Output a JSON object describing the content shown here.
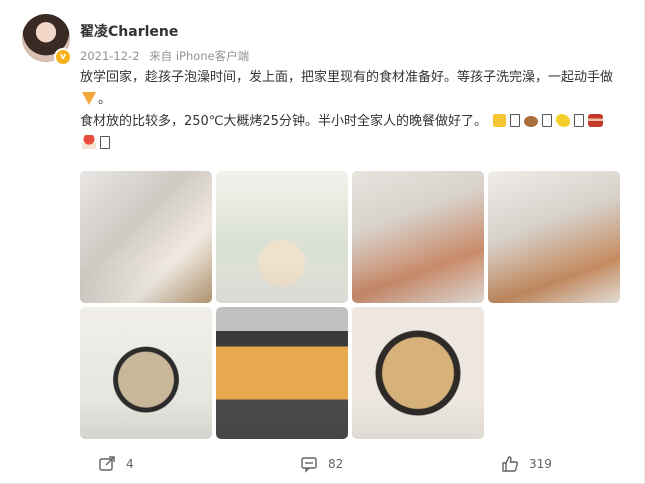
{
  "post": {
    "username": "翟凌Charlene",
    "date": "2021-12-2",
    "source": "来自 iPhone客户端",
    "text_line1": "放学回家，趁孩子泡澡时间，发上面，把家里现有的食材准备好。等孩子洗完澡，一起动手做",
    "text_line2": "食材放的比较多，250℃大概烤25分钟。半小时全家人的晚餐做好了。"
  },
  "icons": {
    "verified": "verified-badge-icon",
    "pizza": "pizza-emoji-icon",
    "cheese": "cheese-emoji-icon",
    "potato": "potato-emoji-icon",
    "corn": "corn-emoji-icon",
    "bacon": "bacon-emoji-icon",
    "mushroom": "mushroom-emoji-icon",
    "missing": "missing-glyph-icon"
  },
  "photos": [
    "photo-1",
    "photo-2",
    "photo-3",
    "photo-4",
    "photo-5",
    "photo-6",
    "photo-7"
  ],
  "actions": {
    "repost_count": "4",
    "comment_count": "82",
    "like_count": "319"
  },
  "colors": {
    "badge": "#f8b21c",
    "text": "#333333",
    "meta": "#939393"
  }
}
